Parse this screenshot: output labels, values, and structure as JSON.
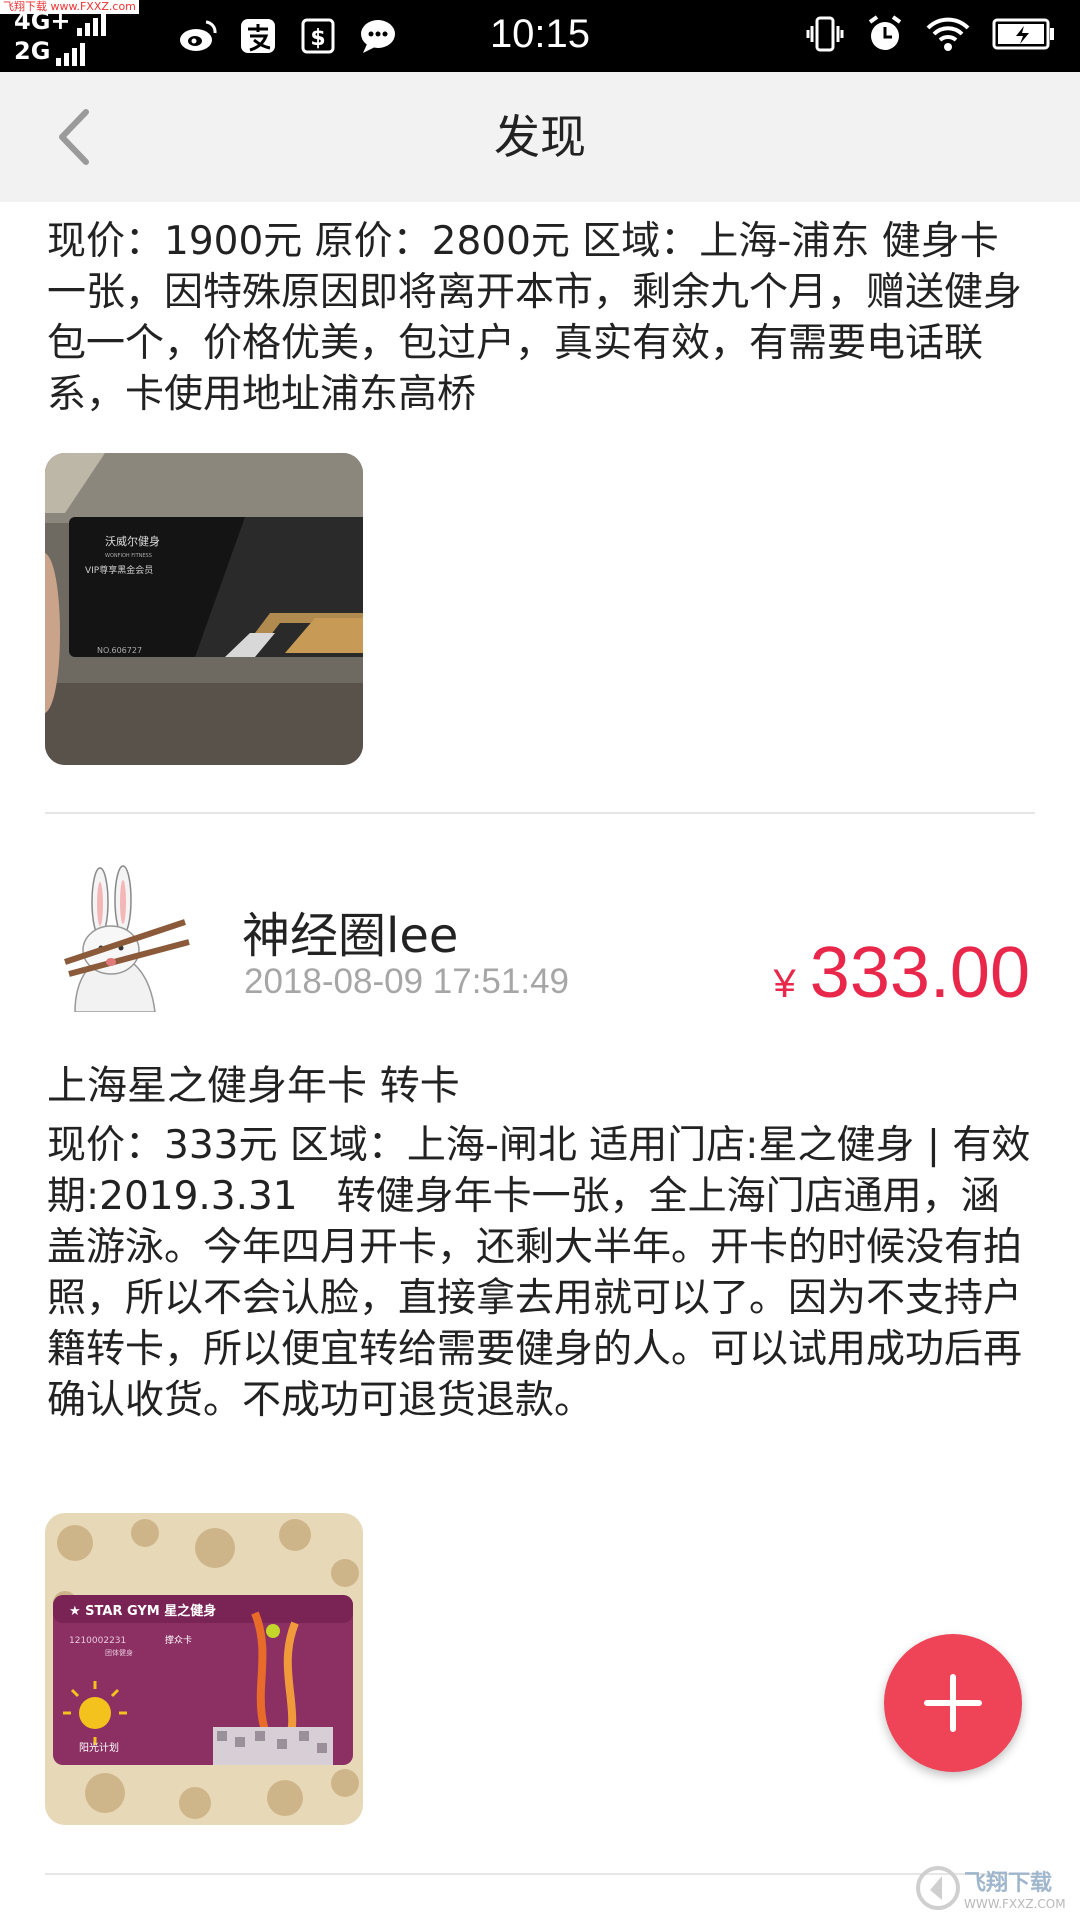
{
  "status_bar": {
    "signal_top": "4G+",
    "signal_bottom": "2G",
    "time": "10:15",
    "site_tag": "飞翔下载 www.FXXZ.com"
  },
  "header": {
    "title": "发现",
    "back_icon": "chevron-left-icon"
  },
  "posts": [
    {
      "description": "现价：1900元 原价：2800元 区域：上海-浦东 健身卡一张，因特殊原因即将离开本市，剩余九个月，赠送健身包一个，价格优美，包过户，真实有效，有需要电话联系，卡使用地址浦东高桥",
      "image": {
        "brand": "沃威尔健身",
        "brand_en": "WONFIOH FITNESS",
        "tier": "VIP尊享黑金会员",
        "number": "NO.606727"
      }
    },
    {
      "user": "神经圈lee",
      "time": "2018-08-09 17:51:49",
      "price_currency": "¥",
      "price": "333.00",
      "title": "上海星之健身年卡 转卡",
      "description": "现价：333元 区域：上海-闸北 适用门店:星之健身 | 有效期:2019.3.31　转健身年卡一张，全上海门店通用，涵盖游泳。今年四月开卡，还剩大半年。开卡的时候没有拍照，所以不会认脸，直接拿去用就可以了。因为不支持户籍转卡，所以便宜转给需要健身的人。可以试用成功后再确认收货。不成功可退货退款。",
      "image": {
        "brand": "★ STAR GYM 星之健身",
        "number": "1210002231",
        "card_type": "撑众卡",
        "card_sub": "团体健身",
        "plan": "阳光计划"
      }
    }
  ],
  "fab": {
    "icon": "plus-icon"
  },
  "watermark": {
    "text": "飞翔下载",
    "url": "WWW.FXXZ.COM"
  },
  "colors": {
    "accent": "#ef4357",
    "price": "#e8274b",
    "header_bg": "#f2f2f2"
  }
}
